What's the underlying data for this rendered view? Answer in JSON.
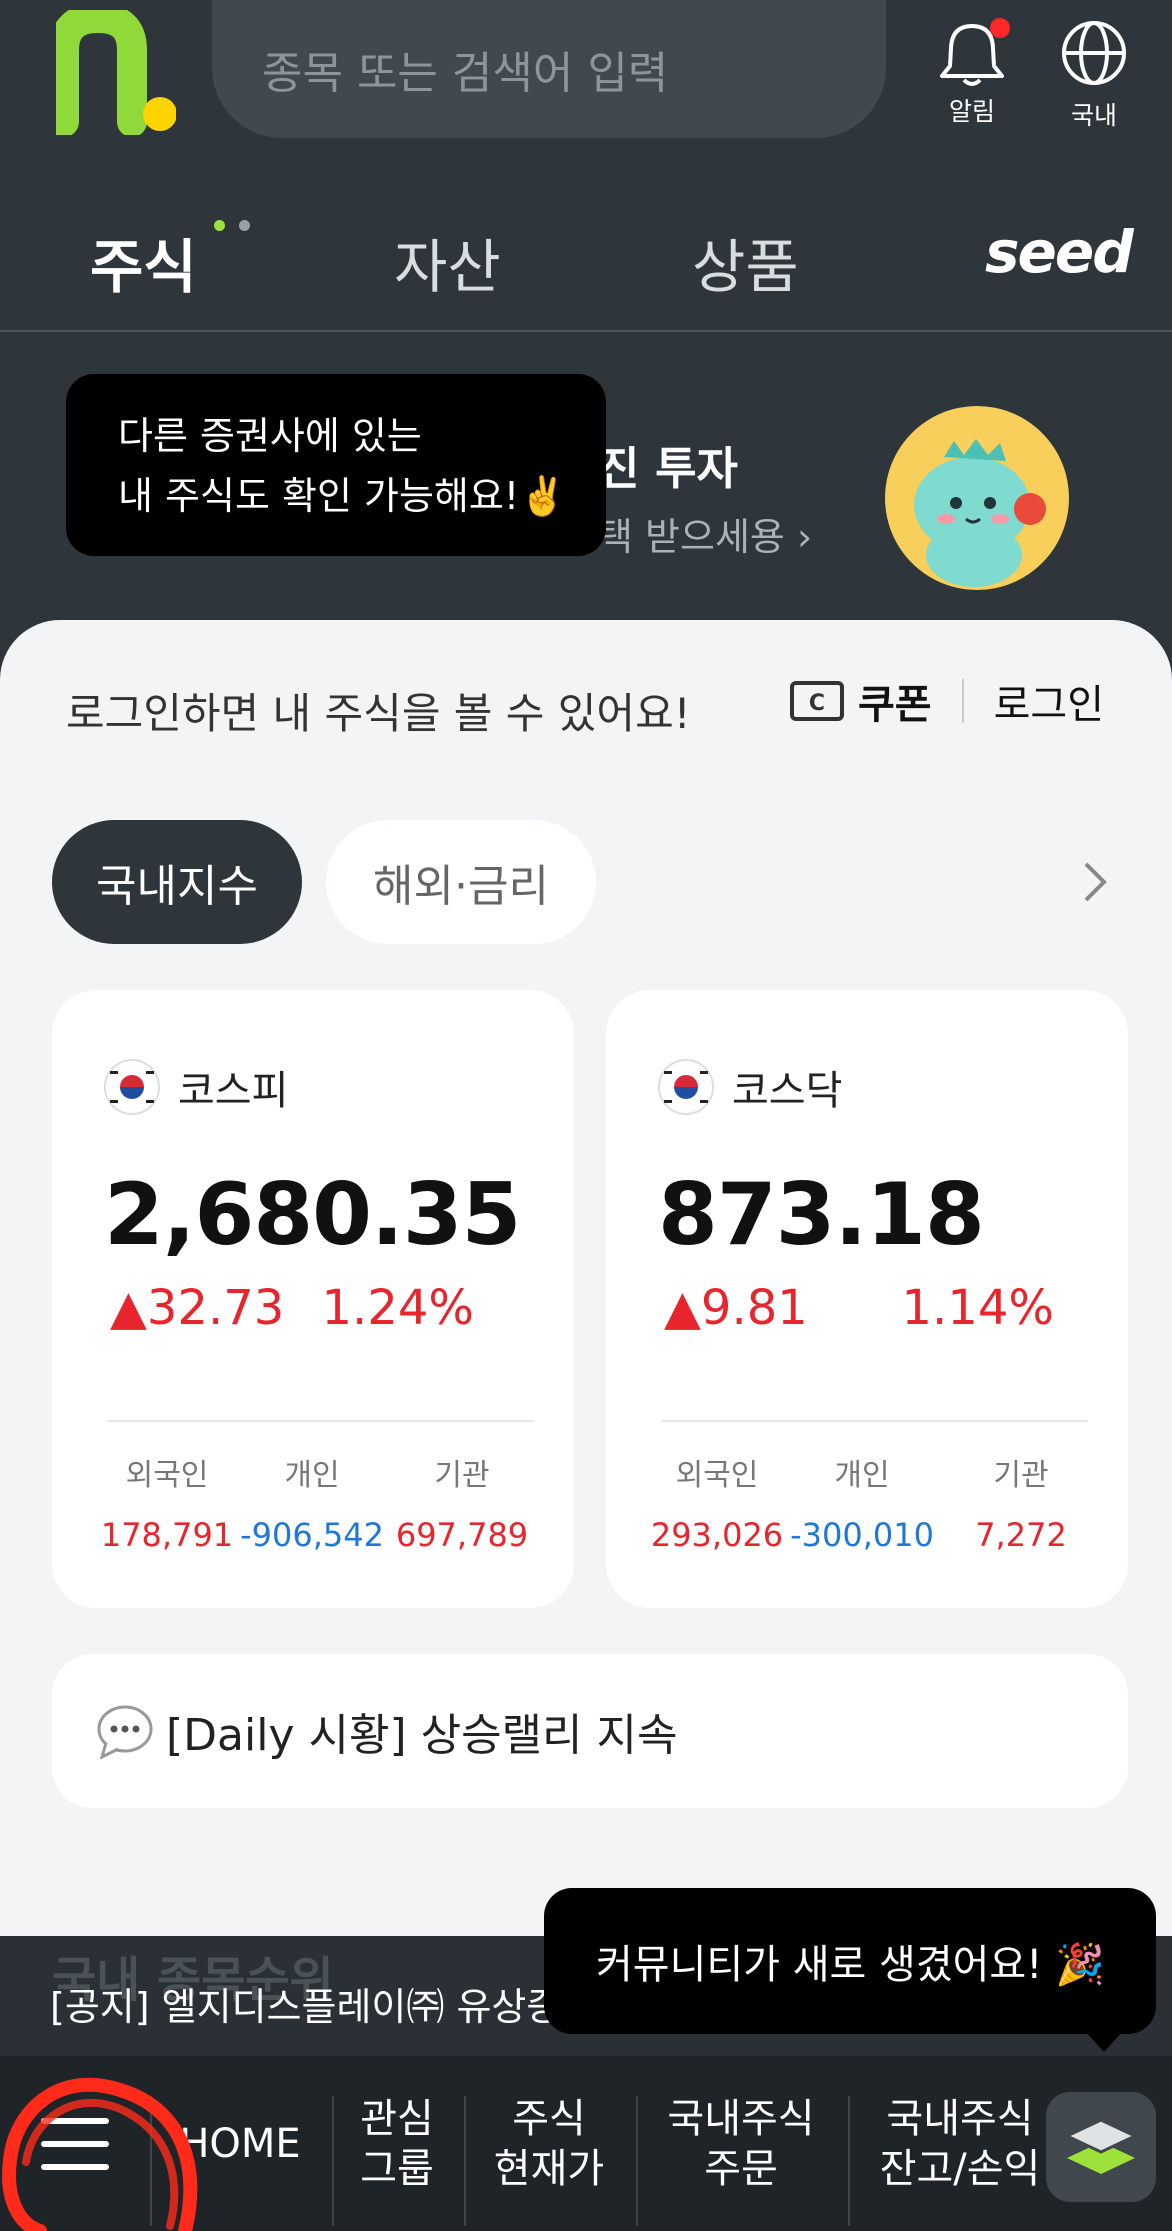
{
  "header": {
    "search_placeholder": "종목 또는 검색어 입력",
    "alarm_label": "알림",
    "region_label": "국내"
  },
  "tabs": [
    {
      "label": "주식",
      "active": true
    },
    {
      "label": "자산"
    },
    {
      "label": "상품"
    },
    {
      "label": "seed"
    }
  ],
  "promo": {
    "title": "진 투자",
    "subtitle": "택 받으세용 ›"
  },
  "tooltip_top": {
    "line1": "다른 증권사에 있는",
    "line2": "내 주식도 확인 가능해요!✌️"
  },
  "login_bar": {
    "message": "로그인하면 내 주식을 볼 수 있어요!",
    "coupon": "쿠폰",
    "login": "로그인"
  },
  "index_tabs": {
    "domestic": "국내지수",
    "global": "해외·금리"
  },
  "cards": [
    {
      "name": "코스피",
      "value": "2,680.35",
      "change": "▲32.73",
      "rate": "1.24%",
      "stats": [
        {
          "label": "외국인",
          "value": "178,791",
          "sign": "pos"
        },
        {
          "label": "개인",
          "value": "-906,542",
          "sign": "neg"
        },
        {
          "label": "기관",
          "value": "697,789",
          "sign": "pos"
        }
      ]
    },
    {
      "name": "코스닥",
      "value": "873.18",
      "change": "▲9.81",
      "rate": "1.14%",
      "stats": [
        {
          "label": "외국인",
          "value": "293,026",
          "sign": "pos"
        },
        {
          "label": "개인",
          "value": "-300,010",
          "sign": "neg"
        },
        {
          "label": "기관",
          "value": "7,272",
          "sign": "pos"
        }
      ]
    }
  ],
  "news": {
    "text": "[Daily 시황] 상승랠리 지속"
  },
  "ticker": {
    "ghost": "국내 종목순위",
    "notice": "[공지] 엘지디스플레이㈜ 유상증"
  },
  "tooltip_bottom": {
    "text": "커뮤니티가 새로 생겼어요! 🎉"
  },
  "bottom_nav": {
    "home": "HOME",
    "watch_l1": "관심",
    "watch_l2": "그룹",
    "price_l1": "주식",
    "price_l2": "현재가",
    "order_l1": "국내주식",
    "order_l2": "주문",
    "balance_l1": "국내주식",
    "balance_l2": "잔고/손익"
  },
  "colors": {
    "bg_dark": "#2e353b",
    "accent_green": "#9de23a",
    "up_red": "#e8242d",
    "down_blue": "#1f78d7",
    "annotation_red": "#ff2a1a"
  }
}
